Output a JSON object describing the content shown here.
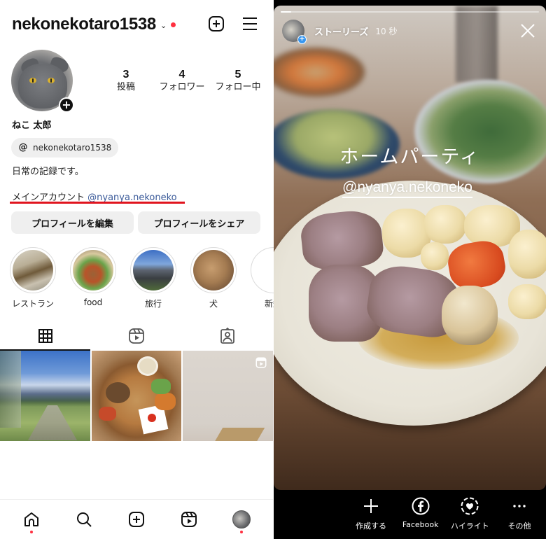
{
  "profile": {
    "username": "nekonekotaro1538",
    "display_name": "ねこ 太郎",
    "stats": [
      {
        "value": "3",
        "label": "投稿"
      },
      {
        "value": "4",
        "label": "フォロワー"
      },
      {
        "value": "5",
        "label": "フォロー中"
      }
    ],
    "threads_handle": "nekonekotaro1538",
    "bio_line1": "日常の記録です。",
    "bio_line2_prefix": "メインアカウント",
    "bio_line2_mention": "@nyanya.nekoneko",
    "buttons": {
      "edit": "プロフィールを編集",
      "share": "プロフィールをシェア"
    },
    "highlights": [
      {
        "label": "レストラン"
      },
      {
        "label": "food"
      },
      {
        "label": "旅行"
      },
      {
        "label": "犬"
      },
      {
        "label": "新規"
      }
    ],
    "tabs": [
      "posts-grid",
      "reels",
      "tagged"
    ],
    "active_tab": "posts-grid"
  },
  "colors": {
    "notification_dot": "#ff3040",
    "mention_link": "#385898",
    "annotation_underline": "#e0141e",
    "story_plus_badge": "#3897f0"
  },
  "story": {
    "user": "ストーリーズ",
    "time": "10 秒",
    "progress": 0.04,
    "title_text": "ホームパーティ",
    "mention_sticker": "@nyanya.nekoneko",
    "actions": [
      {
        "icon": "plus-icon",
        "label": "作成する"
      },
      {
        "icon": "facebook-icon",
        "label": "Facebook"
      },
      {
        "icon": "highlight-heart-icon",
        "label": "ハイライト"
      },
      {
        "icon": "more-icon",
        "label": "その他"
      }
    ]
  }
}
